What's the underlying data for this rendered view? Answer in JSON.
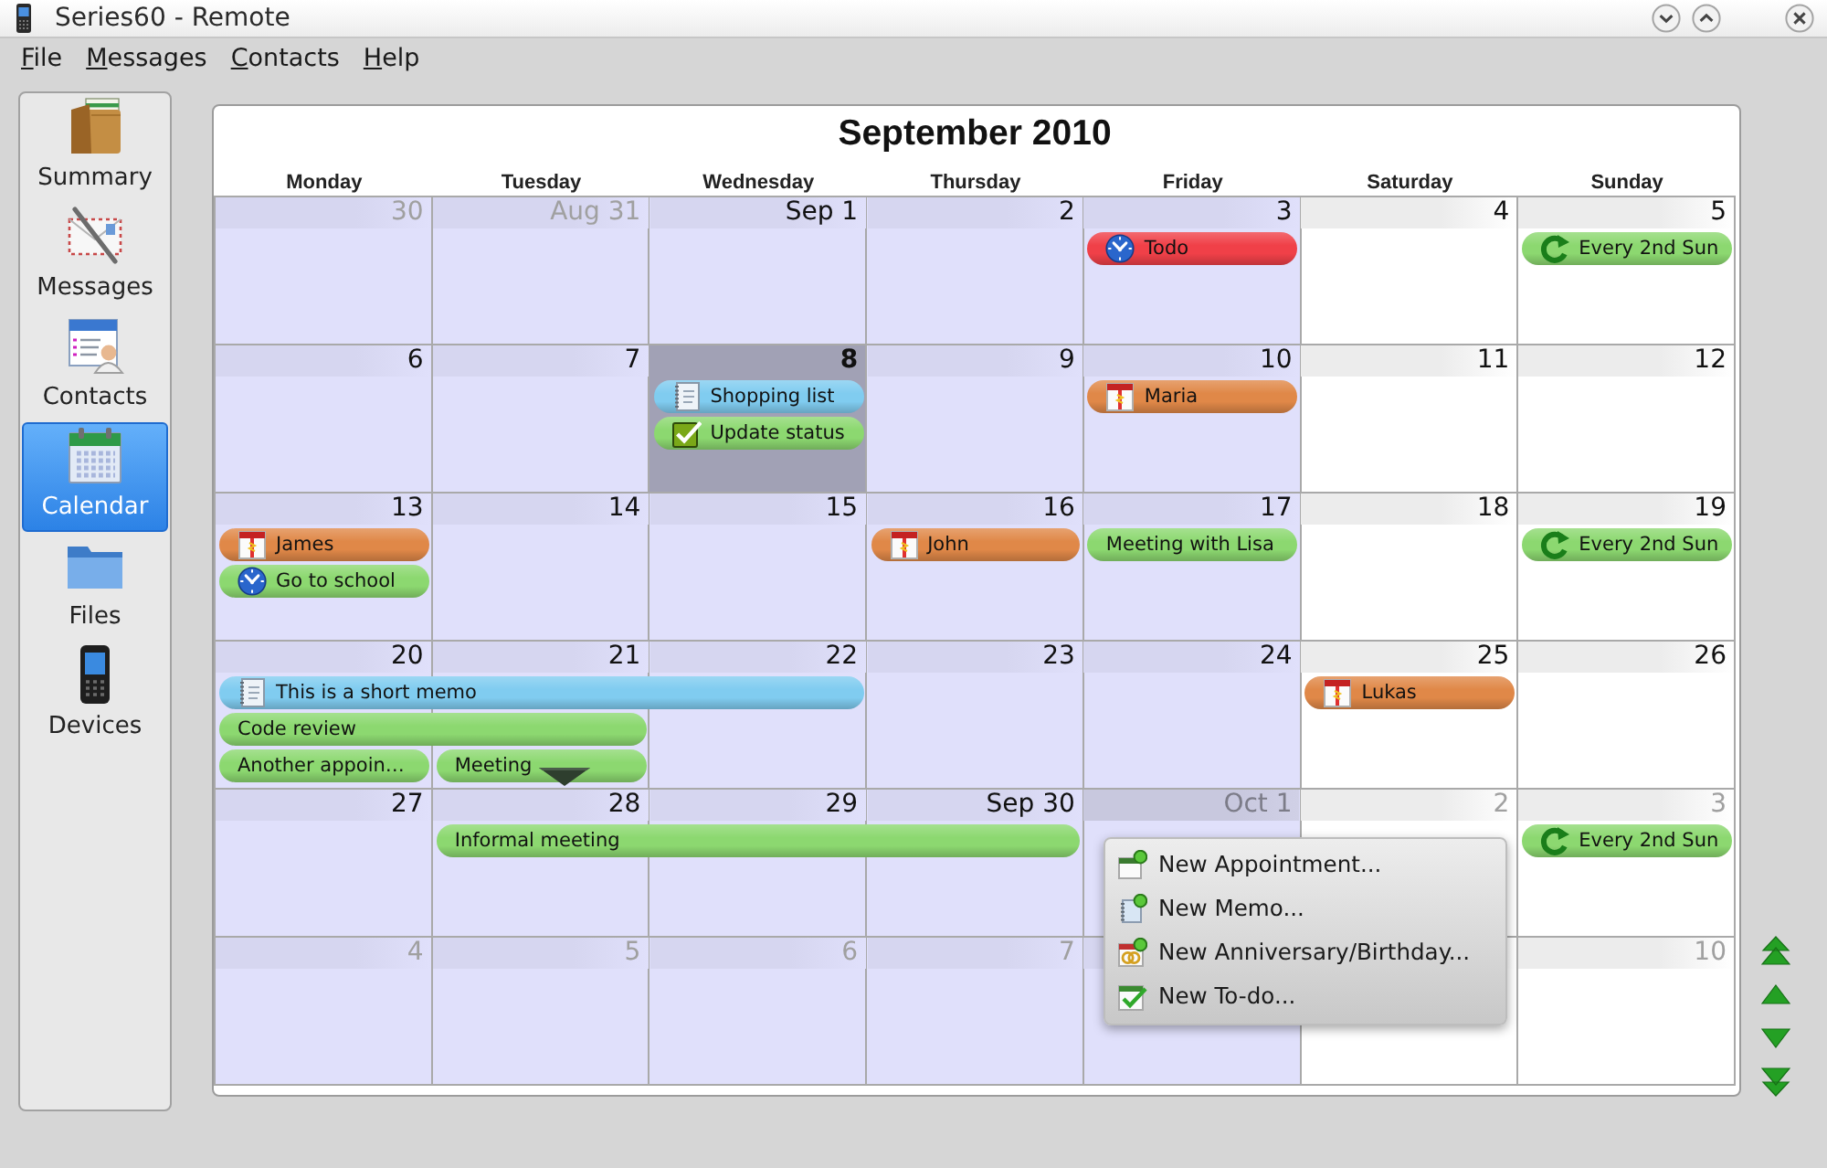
{
  "window": {
    "title": "Series60 - Remote"
  },
  "menu_bar": [
    "File",
    "Messages",
    "Contacts",
    "Help"
  ],
  "sidebar": {
    "items": [
      {
        "label": "Summary",
        "kind": "wallet",
        "selected": false
      },
      {
        "label": "Messages",
        "kind": "envelope",
        "selected": false
      },
      {
        "label": "Contacts",
        "kind": "contact_card",
        "selected": false
      },
      {
        "label": "Calendar",
        "kind": "calendar",
        "selected": true
      },
      {
        "label": "Files",
        "kind": "folder",
        "selected": false
      },
      {
        "label": "Devices",
        "kind": "phone",
        "selected": false
      }
    ]
  },
  "calendar": {
    "title": "September 2010",
    "weekdays": [
      {
        "label": "Monday",
        "weekend": false
      },
      {
        "label": "Tuesday",
        "weekend": false
      },
      {
        "label": "Wednesday",
        "weekend": false
      },
      {
        "label": "Thursday",
        "weekend": false
      },
      {
        "label": "Friday",
        "weekend": false
      },
      {
        "label": "Saturday",
        "weekend": true
      },
      {
        "label": "Sunday",
        "weekend": true
      }
    ],
    "weeks": [
      {
        "days": [
          {
            "label": "30",
            "in_month": false,
            "selected": false,
            "highlighted": false,
            "more": false
          },
          {
            "label": "Aug 31",
            "in_month": false,
            "selected": false,
            "highlighted": false,
            "more": false
          },
          {
            "label": "Sep 1",
            "in_month": true,
            "selected": false,
            "highlighted": false,
            "more": false
          },
          {
            "label": "2",
            "in_month": true,
            "selected": false,
            "highlighted": false,
            "more": false
          },
          {
            "label": "3",
            "in_month": true,
            "selected": false,
            "highlighted": false,
            "more": false,
            "events": [
              {
                "title": "Todo",
                "kind": "todo",
                "color": "#f04048"
              }
            ]
          },
          {
            "label": "4",
            "in_month": true,
            "selected": false,
            "highlighted": false,
            "more": false
          },
          {
            "label": "5",
            "in_month": true,
            "selected": false,
            "highlighted": false,
            "more": false,
            "events": [
              {
                "title": "Every 2nd Sun",
                "kind": "recurring",
                "color": "#8cd870"
              }
            ]
          }
        ]
      },
      {
        "days": [
          {
            "label": "6",
            "in_month": true,
            "selected": false,
            "highlighted": false,
            "more": false
          },
          {
            "label": "7",
            "in_month": true,
            "selected": false,
            "highlighted": false,
            "more": false
          },
          {
            "label": "8",
            "in_month": true,
            "selected": true,
            "highlighted": false,
            "more": false,
            "events": [
              {
                "title": "Shopping list",
                "kind": "memo",
                "color": "#80ccf0"
              },
              {
                "title": "Update status",
                "kind": "todo_done",
                "color": "#8cd870"
              }
            ]
          },
          {
            "label": "9",
            "in_month": true,
            "selected": false,
            "highlighted": false,
            "more": false
          },
          {
            "label": "10",
            "in_month": true,
            "selected": false,
            "highlighted": false,
            "more": false,
            "events": [
              {
                "title": "Maria",
                "kind": "birthday",
                "color": "#e08848"
              }
            ]
          },
          {
            "label": "11",
            "in_month": true,
            "selected": false,
            "highlighted": false,
            "more": false
          },
          {
            "label": "12",
            "in_month": true,
            "selected": false,
            "highlighted": false,
            "more": false
          }
        ]
      },
      {
        "days": [
          {
            "label": "13",
            "in_month": true,
            "selected": false,
            "highlighted": false,
            "more": false,
            "events": [
              {
                "title": "James",
                "kind": "birthday",
                "color": "#e08848"
              },
              {
                "title": "Go to school",
                "kind": "todo",
                "color": "#8cd870"
              }
            ]
          },
          {
            "label": "14",
            "in_month": true,
            "selected": false,
            "highlighted": false,
            "more": false
          },
          {
            "label": "15",
            "in_month": true,
            "selected": false,
            "highlighted": false,
            "more": false
          },
          {
            "label": "16",
            "in_month": true,
            "selected": false,
            "highlighted": false,
            "more": false,
            "events": [
              {
                "title": "John",
                "kind": "birthday",
                "color": "#e08848"
              }
            ]
          },
          {
            "label": "17",
            "in_month": true,
            "selected": false,
            "highlighted": false,
            "more": false,
            "events": [
              {
                "title": "Meeting with Lisa",
                "kind": "appointment",
                "color": "#8cd870"
              }
            ]
          },
          {
            "label": "18",
            "in_month": true,
            "selected": false,
            "highlighted": false,
            "more": false
          },
          {
            "label": "19",
            "in_month": true,
            "selected": false,
            "highlighted": false,
            "more": false,
            "events": [
              {
                "title": "Every 2nd Sun",
                "kind": "recurring",
                "color": "#8cd870"
              }
            ]
          }
        ]
      },
      {
        "days": [
          {
            "label": "20",
            "in_month": true,
            "selected": false,
            "highlighted": false,
            "more": false,
            "events": [
              {
                "title": "This is a short memo",
                "kind": "memo",
                "color": "#80ccf0"
              },
              {
                "title": "Code review",
                "kind": "appointment",
                "color": "#8cd870"
              },
              {
                "title": "Another appoin…",
                "kind": "appointment",
                "color": "#8cd870"
              }
            ]
          },
          {
            "label": "21",
            "in_month": true,
            "selected": false,
            "highlighted": false,
            "more": true,
            "events": [
              {
                "kind": "continuation"
              },
              {
                "kind": "continuation"
              },
              {
                "title": "Meeting",
                "kind": "appointment",
                "color": "#8cd870"
              }
            ]
          },
          {
            "label": "22",
            "in_month": true,
            "selected": false,
            "highlighted": false,
            "more": false,
            "events": [
              {
                "kind": "continuation"
              }
            ]
          },
          {
            "label": "23",
            "in_month": true,
            "selected": false,
            "highlighted": false,
            "more": false
          },
          {
            "label": "24",
            "in_month": true,
            "selected": false,
            "highlighted": false,
            "more": false
          },
          {
            "label": "25",
            "in_month": true,
            "selected": false,
            "highlighted": false,
            "more": false,
            "events": [
              {
                "title": "Lukas",
                "kind": "birthday",
                "color": "#e08848"
              }
            ]
          },
          {
            "label": "26",
            "in_month": true,
            "selected": false,
            "highlighted": false,
            "more": false
          }
        ]
      },
      {
        "days": [
          {
            "label": "27",
            "in_month": true,
            "selected": false,
            "highlighted": false,
            "more": false
          },
          {
            "label": "28",
            "in_month": true,
            "selected": false,
            "highlighted": false,
            "more": false,
            "events": [
              {
                "title": "Informal meeting",
                "kind": "appointment",
                "color": "#8cd870"
              }
            ]
          },
          {
            "label": "29",
            "in_month": true,
            "selected": false,
            "highlighted": false,
            "more": false,
            "events": [
              {
                "kind": "continuation"
              }
            ]
          },
          {
            "label": "Sep 30",
            "in_month": true,
            "selected": false,
            "highlighted": false,
            "more": false,
            "events": [
              {
                "kind": "continuation"
              }
            ]
          },
          {
            "label": "Oct 1",
            "in_month": false,
            "selected": false,
            "highlighted": true,
            "more": false
          },
          {
            "label": "2",
            "in_month": false,
            "selected": false,
            "highlighted": false,
            "more": false
          },
          {
            "label": "3",
            "in_month": false,
            "selected": false,
            "highlighted": false,
            "more": false,
            "events": [
              {
                "title": "Every 2nd Sun",
                "kind": "recurring",
                "color": "#8cd870"
              }
            ]
          }
        ]
      },
      {
        "days": [
          {
            "label": "4",
            "in_month": false,
            "selected": false,
            "highlighted": false,
            "more": false
          },
          {
            "label": "5",
            "in_month": false,
            "selected": false,
            "highlighted": false,
            "more": false
          },
          {
            "label": "6",
            "in_month": false,
            "selected": false,
            "highlighted": false,
            "more": false
          },
          {
            "label": "7",
            "in_month": false,
            "selected": false,
            "highlighted": false,
            "more": false
          },
          {
            "selected": false,
            "more": false
          },
          {
            "selected": false,
            "more": false
          },
          {
            "label": "10",
            "in_month": false,
            "selected": false,
            "highlighted": false,
            "more": false
          }
        ]
      }
    ]
  },
  "context_menu": {
    "items": [
      {
        "label": "New Appointment...",
        "kind": "appointment"
      },
      {
        "label": "New Memo...",
        "kind": "memo"
      },
      {
        "label": "New Anniversary/Birthday...",
        "kind": "anniversary"
      },
      {
        "label": "New To-do...",
        "kind": "todo"
      }
    ]
  }
}
